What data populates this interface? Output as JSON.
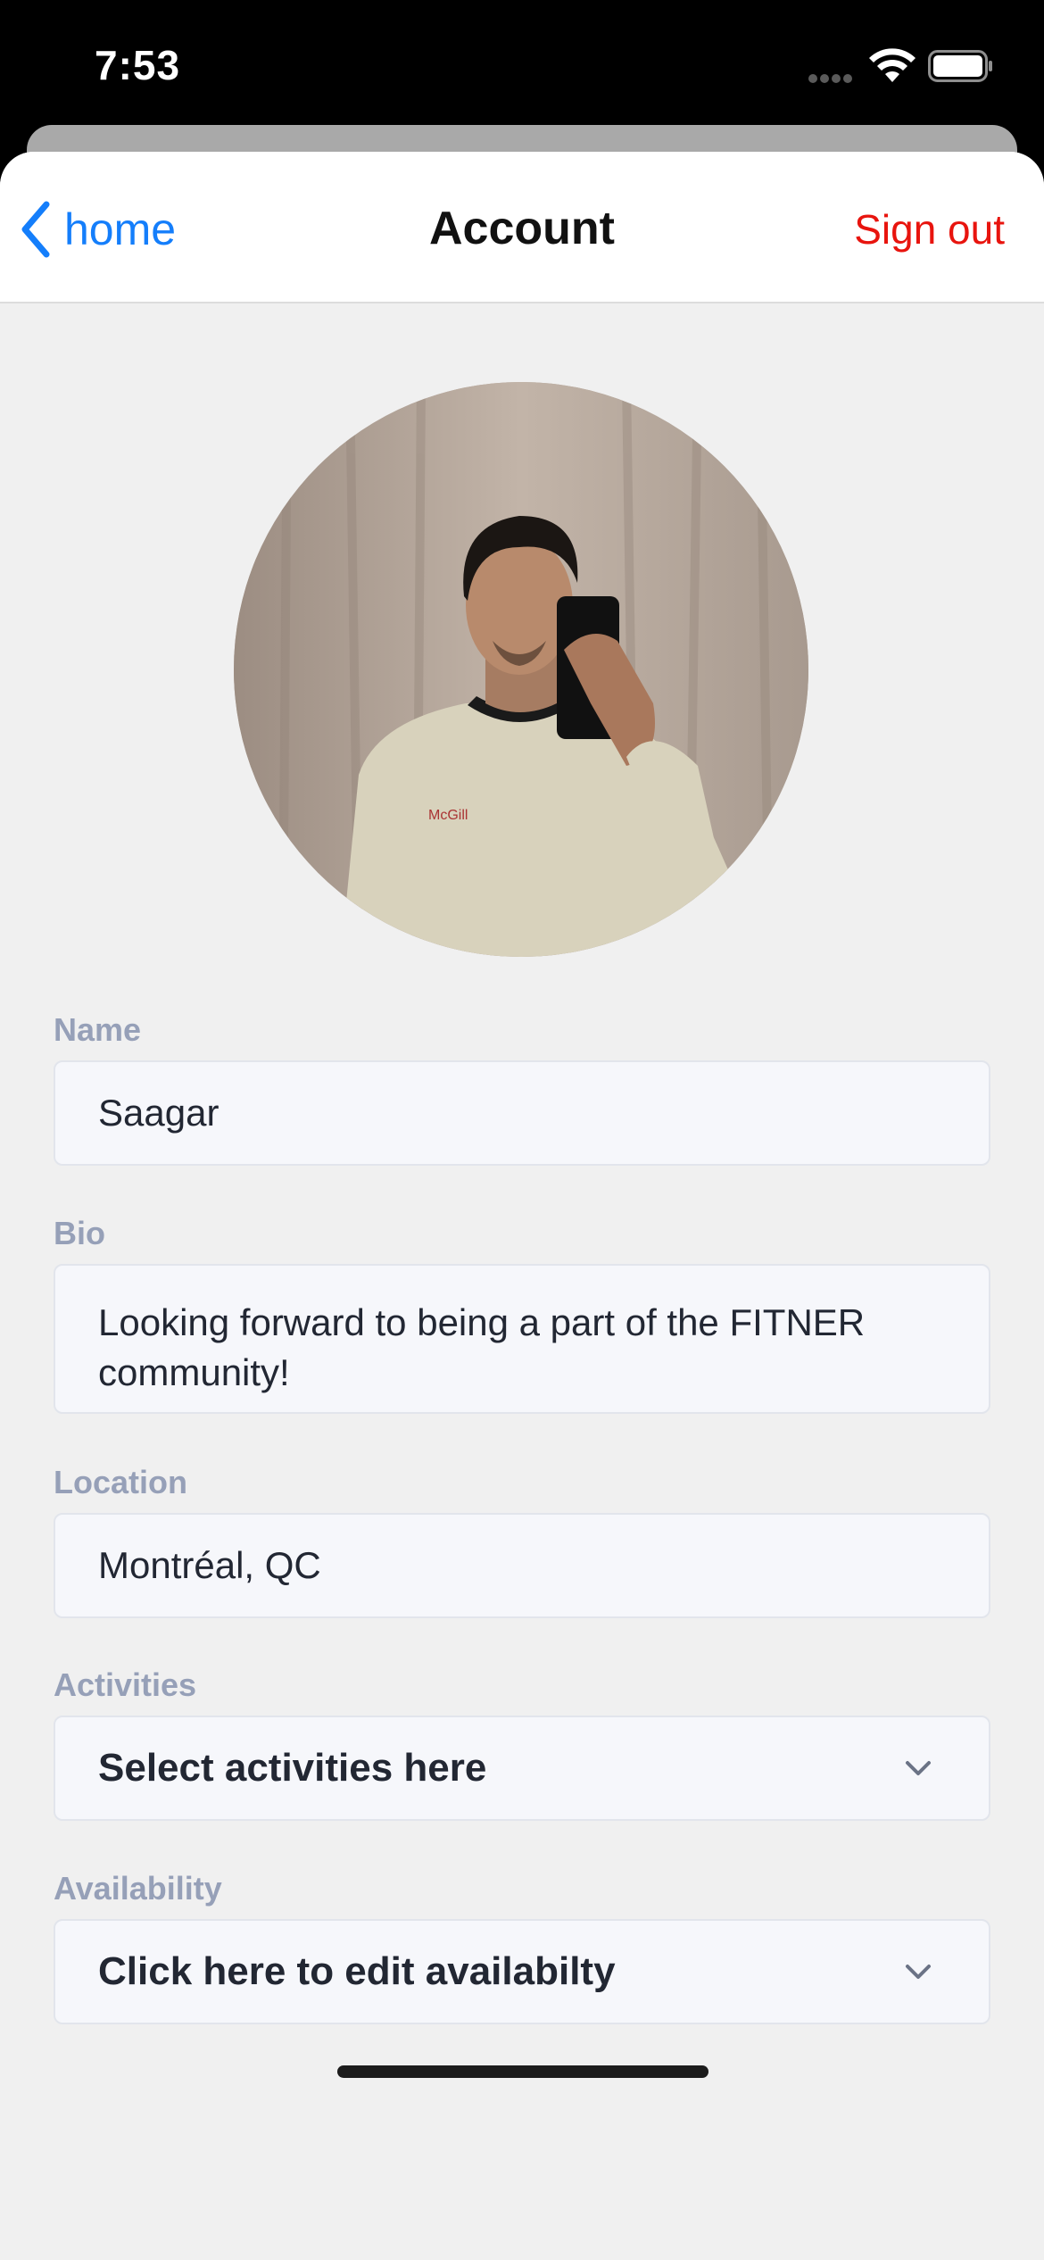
{
  "status_bar": {
    "time": "7:53",
    "icons": [
      "cellular-icon",
      "wifi-icon",
      "battery-icon"
    ]
  },
  "nav": {
    "back_label": "home",
    "title": "Account",
    "signout_label": "Sign out",
    "accent_color": "#147efb",
    "signout_color": "#e8140e"
  },
  "profile": {
    "avatar": "profile-photo"
  },
  "form": {
    "name": {
      "label": "Name",
      "value": "Saagar"
    },
    "bio": {
      "label": "Bio",
      "value": "Looking forward to being a part of the FITNER community!"
    },
    "location": {
      "label": "Location",
      "value": "Montréal, QC"
    },
    "activities": {
      "label": "Activities",
      "value": "Select activities here"
    },
    "availability": {
      "label": "Availability",
      "value": "Click here to edit availabilty"
    }
  }
}
